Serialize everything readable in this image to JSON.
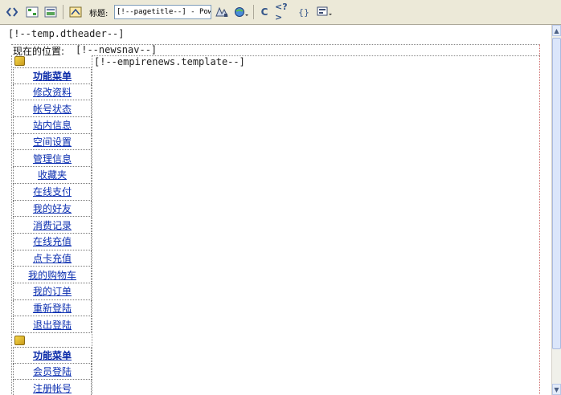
{
  "toolbar": {
    "title_label": "标题:",
    "title_value": "[!--pagetitle--] - Powere",
    "refresh_glyph": "C",
    "code_glyph": "<?>",
    "braces_glyph": "{}"
  },
  "canvas": {
    "header_tag": "[!--temp.dtheader--]",
    "location_label": "现在的位置:",
    "newsnav_tag": "[!--newsnav--]",
    "content_tag": "[!--empirenews.template--]"
  },
  "sidebar": {
    "group1": {
      "heading": "功能菜单",
      "items": [
        "修改资料",
        "帐号状态",
        "站内信息",
        "空间设置",
        "管理信息",
        "收藏夹",
        "在线支付",
        "我的好友",
        "消费记录",
        "在线充值",
        "点卡充值",
        "我的购物车",
        "我的订单",
        "重新登陆",
        "退出登陆"
      ]
    },
    "group2": {
      "heading": "功能菜单",
      "items": [
        "会员登陆",
        "注册帐号"
      ]
    }
  },
  "scrollbar": {
    "up": "▲",
    "down": "▼"
  },
  "colors": {
    "link": "#0c2fb0",
    "toolbar_bg": "#ece9d8"
  }
}
